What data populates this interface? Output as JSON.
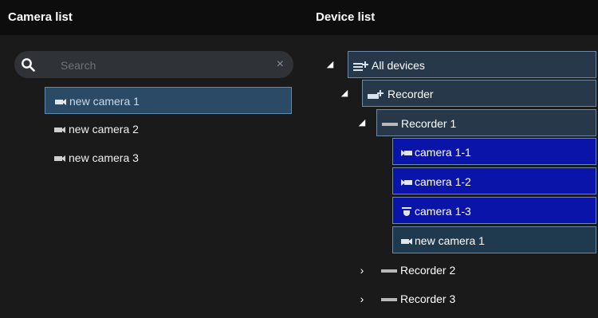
{
  "camera_list": {
    "title": "Camera list",
    "search": {
      "placeholder": "Search",
      "value": ""
    },
    "items": [
      {
        "label": "new camera 1",
        "selected": true
      },
      {
        "label": "new camera 2",
        "selected": false
      },
      {
        "label": "new camera 3",
        "selected": false
      }
    ]
  },
  "device_list": {
    "title": "Device list",
    "all_devices": "All devices",
    "recorder_group": "Recorder",
    "recorders": [
      {
        "label": "Recorder 1",
        "expanded": true,
        "cameras": [
          "camera 1-1",
          "camera 1-2",
          "camera 1-3",
          "new camera 1"
        ]
      },
      {
        "label": "Recorder 2",
        "expanded": false
      },
      {
        "label": "Recorder 3",
        "expanded": false
      }
    ]
  },
  "colors": {
    "background": "#1a1a1a",
    "header": "#0d0d0d",
    "selected_item": "#2b4a66",
    "camera_row_blue": "#0a14a8",
    "accent_border": "#6c8aa6"
  }
}
